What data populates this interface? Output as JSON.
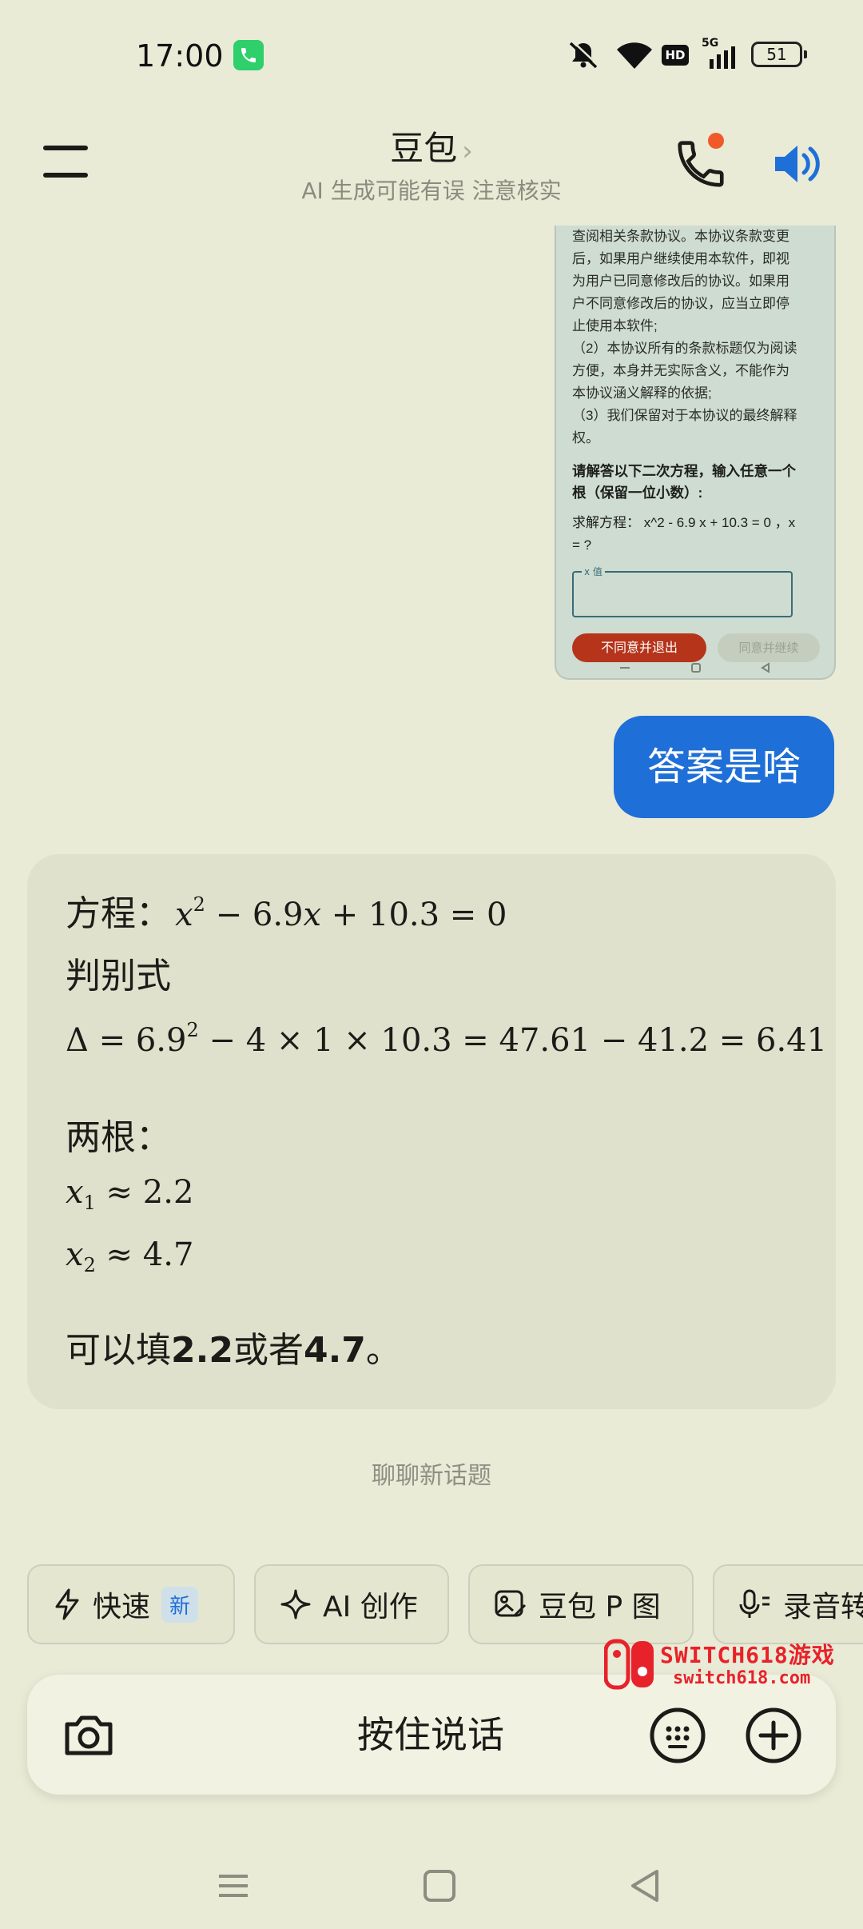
{
  "status_bar": {
    "time": "17:00",
    "call_indicator_icon": "phone-icon",
    "hd_label": "HD",
    "network_label": "5G",
    "battery_level": "51",
    "colors": {
      "call_badge": "#2fcf6b"
    }
  },
  "header": {
    "title": "豆包",
    "title_chevron": "›",
    "subtitle": "AI 生成可能有误 注意核实",
    "icons": [
      "menu-icon",
      "phone-icon",
      "speaker-icon"
    ],
    "colors": {
      "notification_dot": "#f05a28",
      "speaker": "#1f6fd8"
    }
  },
  "screenshot_message": {
    "clause_lines": [
      "查阅相关条款协议。本协议条款变更",
      "后，如果用户继续使用本软件，即视",
      "为用户已同意修改后的协议。如果用",
      "户不同意修改后的协议，应当立即停",
      "止使用本软件;",
      "（2）本协议所有的条款标题仅为阅读",
      "方便，本身并无实际含义，不能作为",
      "本协议涵义解释的依据;",
      "（3）我们保留对于本协议的最终解释",
      "权。"
    ],
    "prompt_lines": [
      "请解答以下二次方程，输入任意一个",
      "根（保留一位小数）:"
    ],
    "equation_lines": [
      "求解方程： x^2 - 6.9 x + 10.3 = 0 ，x",
      "= ?"
    ],
    "field_label": "x 值",
    "decline_button": "不同意并退出",
    "accept_button": "同意并继续"
  },
  "user_message": {
    "text": "答案是啥"
  },
  "answer": {
    "equation_label": "方程：",
    "discriminant_label": "判别式",
    "roots_label": "两根：",
    "conclusion_prefix": "可以填",
    "conclusion_value_1": "2.2",
    "conclusion_middle": "或者",
    "conclusion_value_2": "4.7",
    "conclusion_suffix": "。",
    "math": {
      "a": "1",
      "b": "6.9",
      "c": "10.3",
      "b_squared": "47.61",
      "four_ac": "41.2",
      "delta": "6.41",
      "x1": "2.2",
      "x2": "4.7"
    }
  },
  "new_topic_label": "聊聊新话题",
  "chips": [
    {
      "label": "快速",
      "badge": "新",
      "icon": "lightning-icon"
    },
    {
      "label": "AI 创作",
      "icon": "sparkle-icon"
    },
    {
      "label": "豆包 P 图",
      "icon": "image-edit-icon"
    },
    {
      "label": "录音转",
      "icon": "mic-icon"
    }
  ],
  "input_bar": {
    "hold_to_talk": "按住说话",
    "icons": [
      "camera-icon",
      "keyboard-icon",
      "plus-icon"
    ]
  },
  "watermark": {
    "line1": "SWITCH618游戏",
    "line2": "switch618.com",
    "color": "#e8222a"
  },
  "system_nav": {
    "icons": [
      "recents-icon",
      "home-icon",
      "back-icon"
    ]
  }
}
